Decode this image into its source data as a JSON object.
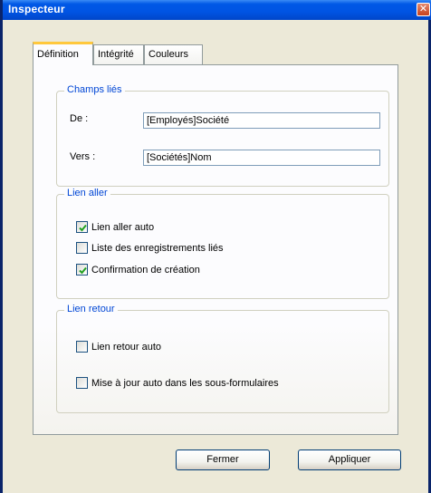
{
  "window": {
    "title": "Inspecteur"
  },
  "tabs": [
    {
      "label": "Définition",
      "active": true
    },
    {
      "label": "Intégrité",
      "active": false
    },
    {
      "label": "Couleurs",
      "active": false
    }
  ],
  "champs_lies": {
    "legend": "Champs liés",
    "de_label": "De :",
    "de_value": "[Employés]Société",
    "vers_label": "Vers :",
    "vers_value": "[Sociétés]Nom"
  },
  "lien_aller": {
    "legend": "Lien aller",
    "options": [
      {
        "label": "Lien aller auto",
        "checked": true
      },
      {
        "label": "Liste des enregistrements liés",
        "checked": false
      },
      {
        "label": "Confirmation de création",
        "checked": true
      }
    ]
  },
  "lien_retour": {
    "legend": "Lien retour",
    "options": [
      {
        "label": "Lien retour auto",
        "checked": false
      },
      {
        "label": "Mise à jour auto dans les sous-formulaires",
        "checked": false
      }
    ]
  },
  "buttons": {
    "close": "Fermer",
    "apply": "Appliquer"
  },
  "colors": {
    "accent": "#0046d5",
    "title_bar": "#0054e3",
    "tab_highlight": "#ffc83c"
  },
  "icons": {
    "close": "close-icon",
    "check": "check-icon"
  }
}
